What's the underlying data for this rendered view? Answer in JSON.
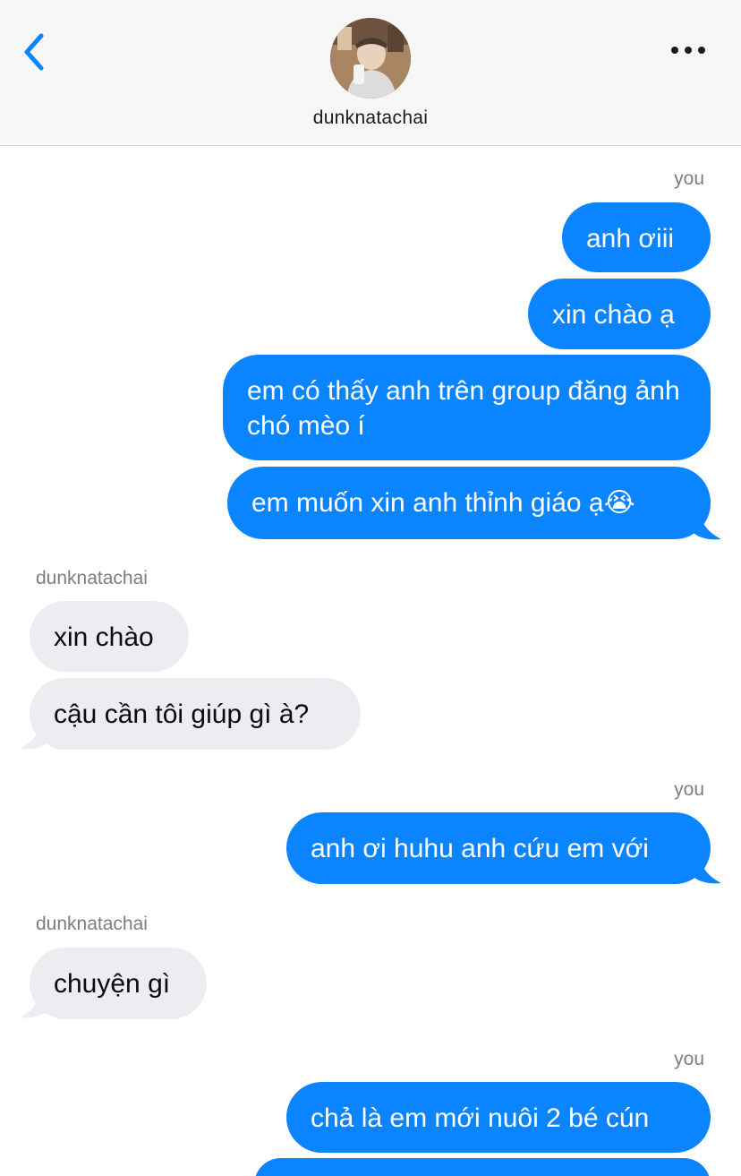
{
  "header": {
    "back_icon": "chevron-left-icon",
    "contact_name": "dunknatachai",
    "more_icon": "ellipsis-icon",
    "accent_color": "#0a84ff"
  },
  "labels": {
    "you": "you",
    "contact": "dunknatachai"
  },
  "messages": [
    {
      "from": "you",
      "text": "anh ơiii"
    },
    {
      "from": "you",
      "text": "xin chào ạ"
    },
    {
      "from": "you",
      "text": "em có thấy anh trên group đăng ảnh chó mèo í"
    },
    {
      "from": "you",
      "text": "em muốn xin anh thỉnh giáo ạ😭"
    },
    {
      "from": "contact",
      "text": "xin chào"
    },
    {
      "from": "contact",
      "text": "cậu cần tôi giúp gì à?"
    },
    {
      "from": "you",
      "text": "anh ơi huhu anh cứu em với"
    },
    {
      "from": "contact",
      "text": "chuyện gì"
    },
    {
      "from": "you",
      "text": "chả là em mới nuôi 2 bé cún"
    }
  ],
  "colors": {
    "outgoing_bubble": "#0a84ff",
    "incoming_bubble": "#ececf1"
  }
}
